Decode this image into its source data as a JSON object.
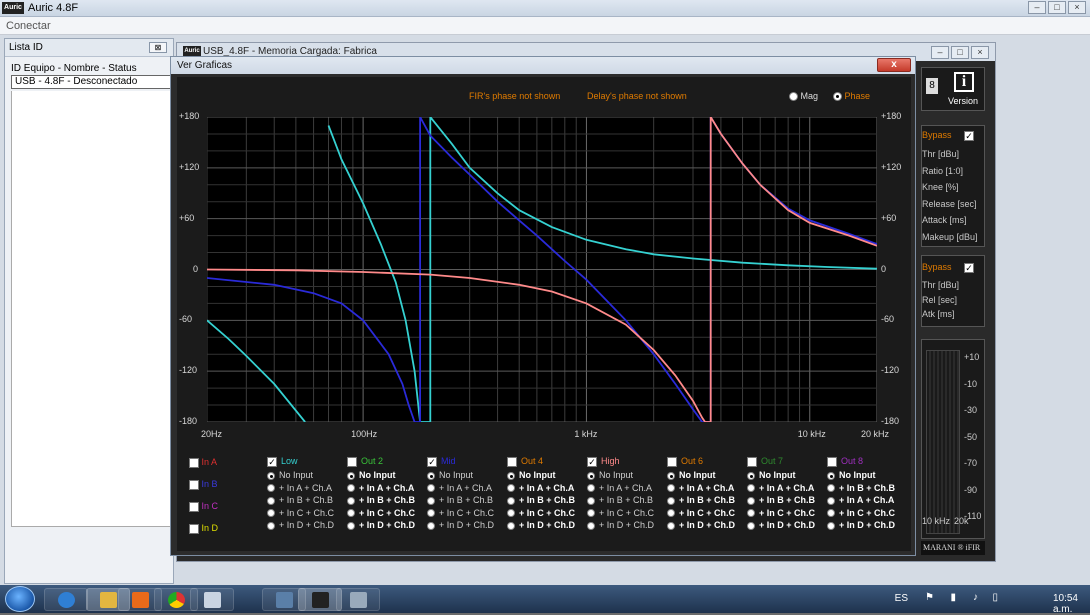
{
  "app": {
    "title": "Auric 4.8F",
    "logo": "Auric",
    "menu": "Conectar"
  },
  "lista": {
    "title": "Lista ID",
    "columns": "ID Equipo - Nombre - Status",
    "row": "USB - 4.8F - Desconectado"
  },
  "device_window": {
    "title": "USB_4.8F - Memoria Cargada: Fabrica",
    "version_label": "Version",
    "display_digit": "8",
    "comp1": {
      "bypass": "Bypass",
      "params": [
        "Thr [dBu]",
        "Ratio [1:0]",
        "Knee [%]",
        "Release [sec]",
        "Attack [ms]",
        "Makeup [dBu]"
      ]
    },
    "comp2": {
      "bypass": "Bypass",
      "params": [
        "Thr [dBu]",
        "Rel [sec]",
        "Atk [ms]"
      ]
    },
    "meter_ticks": [
      "+10",
      "-10",
      "-30",
      "-50",
      "-70",
      "-90",
      "-110"
    ],
    "freq_labels": [
      "10 kHz",
      "20k"
    ],
    "brand": "MARANI ® iFIR"
  },
  "graph_window": {
    "title": "Ver Graficas",
    "close": "x",
    "notes": [
      "FIR's phase not shown",
      "Delay's phase not shown"
    ],
    "mode_mag": "Mag",
    "mode_phase": "Phase",
    "selected_mode": "Phase",
    "y_ticks": [
      "+180",
      "+120",
      "+60",
      "0",
      "-60",
      "-120",
      "-180"
    ],
    "x_ticks": [
      "20Hz",
      "100Hz",
      "1 kHz",
      "10 kHz",
      "20 kHz"
    ]
  },
  "chart_data": {
    "type": "line",
    "xscale": "log",
    "xlim": [
      20,
      20000
    ],
    "ylim": [
      -180,
      180
    ],
    "grid": true,
    "series": [
      {
        "color": "#35d1d1",
        "x": [
          20,
          25,
          30,
          40,
          55,
          62,
          70,
          80,
          100,
          120,
          140,
          155,
          170,
          180,
          200,
          250,
          300,
          400,
          500,
          700,
          1000,
          1500,
          2000,
          3000,
          5000,
          8000,
          12000,
          20000
        ],
        "y": [
          -60,
          -82,
          -102,
          -135,
          -180,
          null,
          170,
          130,
          78,
          30,
          -15,
          -60,
          -120,
          -180,
          180,
          148,
          120,
          90,
          70,
          50,
          35,
          24,
          18,
          13,
          8,
          5,
          3,
          1
        ]
      },
      {
        "color": "#2a2ad8",
        "x": [
          20,
          40,
          60,
          80,
          100,
          130,
          150,
          160,
          170,
          180,
          200,
          250,
          300,
          400,
          500,
          600,
          800,
          1000,
          1500,
          2000,
          2500,
          3000,
          3300,
          3600,
          4000,
          5000,
          6000,
          8000,
          10000,
          15000,
          20000
        ],
        "y": [
          -10,
          -18,
          -28,
          -40,
          -60,
          -100,
          -135,
          -160,
          -180,
          180,
          158,
          132,
          112,
          80,
          58,
          40,
          10,
          -12,
          -60,
          -100,
          -135,
          -165,
          -180,
          180,
          160,
          125,
          100,
          72,
          58,
          42,
          30
        ]
      },
      {
        "color": "#ff8a8a",
        "x": [
          20,
          50,
          100,
          200,
          300,
          500,
          700,
          1000,
          1500,
          2000,
          2500,
          3000,
          3300,
          3400,
          3600,
          4000,
          5000,
          6000,
          8000,
          10000,
          15000,
          20000
        ],
        "y": [
          0,
          -1,
          -3,
          -6,
          -10,
          -18,
          -26,
          -40,
          -65,
          -95,
          -125,
          -155,
          -175,
          -180,
          180,
          160,
          125,
          100,
          70,
          55,
          40,
          28
        ]
      }
    ]
  },
  "channels": {
    "inputs": [
      {
        "label": "In A",
        "color": "#e03030"
      },
      {
        "label": "In B",
        "color": "#3a3adf"
      },
      {
        "label": "In C",
        "color": "#c030c0"
      },
      {
        "label": "In D",
        "color": "#e0e000"
      }
    ],
    "outputs": [
      {
        "label": "Low",
        "color": "#35d1d1",
        "checked": true,
        "selected": 0,
        "bold": false
      },
      {
        "label": "Out 2",
        "color": "#3ac43a",
        "checked": false,
        "selected": 0,
        "bold": true
      },
      {
        "label": "Mid",
        "color": "#2a2ad8",
        "checked": true,
        "selected": 0,
        "bold": false
      },
      {
        "label": "Out 4",
        "color": "#e07b00",
        "checked": false,
        "selected": 0,
        "bold": true
      },
      {
        "label": "High",
        "color": "#ff8a8a",
        "checked": true,
        "selected": 0,
        "bold": false
      },
      {
        "label": "Out 6",
        "color": "#e07b00",
        "checked": false,
        "selected": 0,
        "bold": true
      },
      {
        "label": "Out 7",
        "color": "#2f8a2f",
        "checked": false,
        "selected": 0,
        "bold": true
      },
      {
        "label": "Out 8",
        "color": "#a030c0",
        "checked": false,
        "selected": 0,
        "bold": true
      }
    ],
    "options": [
      "No Input",
      "+ In A + Ch.A",
      "+ In B + Ch.B",
      "+ In C + Ch.C",
      "+ In D + Ch.D"
    ],
    "options_out8": [
      "No Input",
      "+ In B + Ch.B",
      "+ In A + Ch.A",
      "+ In C + Ch.C",
      "+ In D + Ch.D"
    ]
  },
  "taskbar": {
    "lang": "ES",
    "time": "10:54 a.m."
  }
}
